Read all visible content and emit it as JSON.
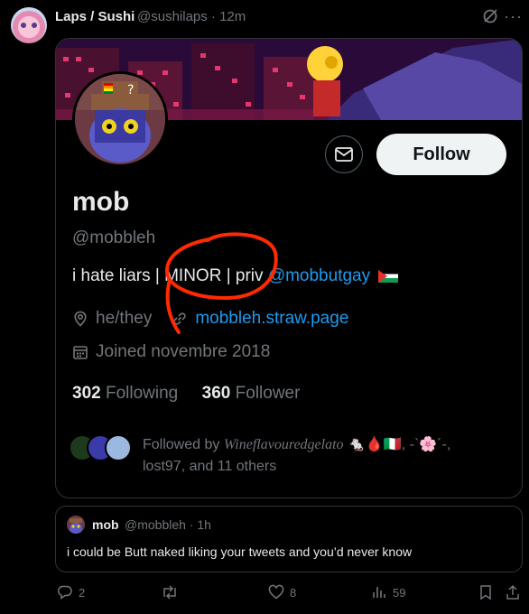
{
  "tweet": {
    "author_name": "Laps / Sushi",
    "author_handle_time": "@sushilaps · 12m",
    "more_label": "···"
  },
  "card": {
    "name": "mob",
    "handle": "@mobbleh",
    "bio_text": "i hate liars | MINOR | priv ",
    "bio_link": "@mobbutgay",
    "pronouns": "he/they",
    "website": "mobbleh.straw.page",
    "joined": "Joined novembre 2018",
    "following_count": "302",
    "following_label": "Following",
    "follower_count": "360",
    "follower_label": "Follower",
    "follow_button": "Follow",
    "followed_by_prefix": "Followed by ",
    "followed_by_name": "Wineflavouredgelato",
    "followed_by_suffix": " 🐁🩸🇮🇹, -`🌸´-,",
    "followed_by_rest": "lost97, and 11 others"
  },
  "quote": {
    "name": "mob",
    "handle_time": "@mobbleh · 1h",
    "text": "i could be Butt naked liking your tweets and you’d never know"
  },
  "actions": {
    "replies": "2",
    "likes": "8",
    "views": "59"
  },
  "colors": {
    "accent": "#1d9bf0",
    "annotation": "#ff2a00",
    "background": "#000000"
  }
}
